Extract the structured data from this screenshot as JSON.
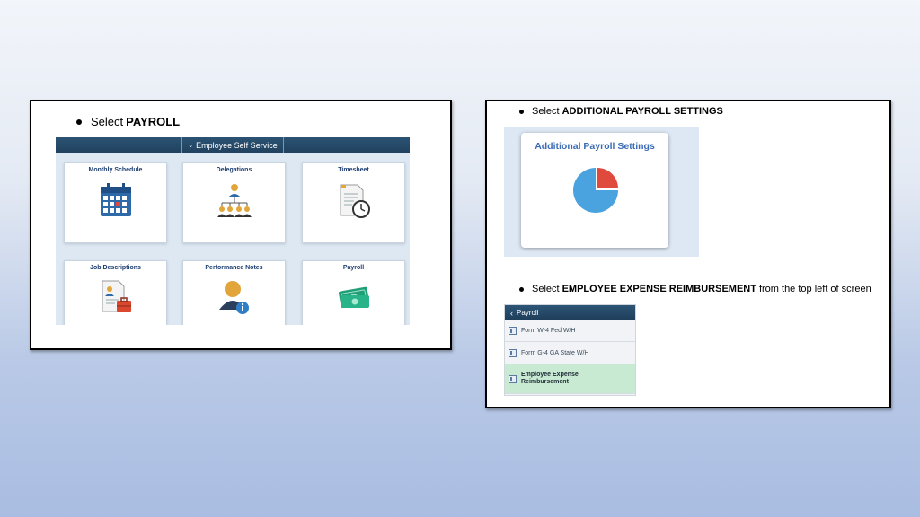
{
  "left_panel": {
    "instruction": {
      "prefix": "Select",
      "emphasis": "PAYROLL"
    },
    "ess": {
      "title": "Employee Self Service",
      "tiles": [
        {
          "label": "Monthly Schedule",
          "icon": "calendar-icon"
        },
        {
          "label": "Delegations",
          "icon": "org-chart-icon"
        },
        {
          "label": "Timesheet",
          "icon": "timesheet-clock-icon"
        },
        {
          "label": "Job Descriptions",
          "icon": "job-description-briefcase-icon"
        },
        {
          "label": "Performance Notes",
          "icon": "person-info-icon"
        },
        {
          "label": "Payroll",
          "icon": "money-icon"
        }
      ]
    }
  },
  "right_panel": {
    "instruction_1": {
      "prefix": "Select",
      "emphasis": "ADDITIONAL PAYROLL SETTINGS"
    },
    "settings_tile": {
      "label": "Additional Payroll Settings",
      "icon": "pie-chart-icon"
    },
    "instruction_2": {
      "prefix": "Select",
      "emphasis": "EMPLOYEE EXPENSE REIMBURSEMENT",
      "suffix": "from the top left of screen"
    },
    "payroll_nav": {
      "back_label": "Payroll",
      "items": [
        {
          "label": "Form W-4 Fed W/H",
          "selected": false
        },
        {
          "label": "Form G-4 GA State W/H",
          "selected": false
        },
        {
          "label": "Employee Expense Reimbursement",
          "selected": true
        }
      ]
    }
  },
  "colors": {
    "header_blue": "#1f405d",
    "tile_title_blue": "#1c3d70",
    "pie_blue": "#4aa3df",
    "pie_red": "#e04a3c",
    "selected_green": "#c9ead2"
  }
}
